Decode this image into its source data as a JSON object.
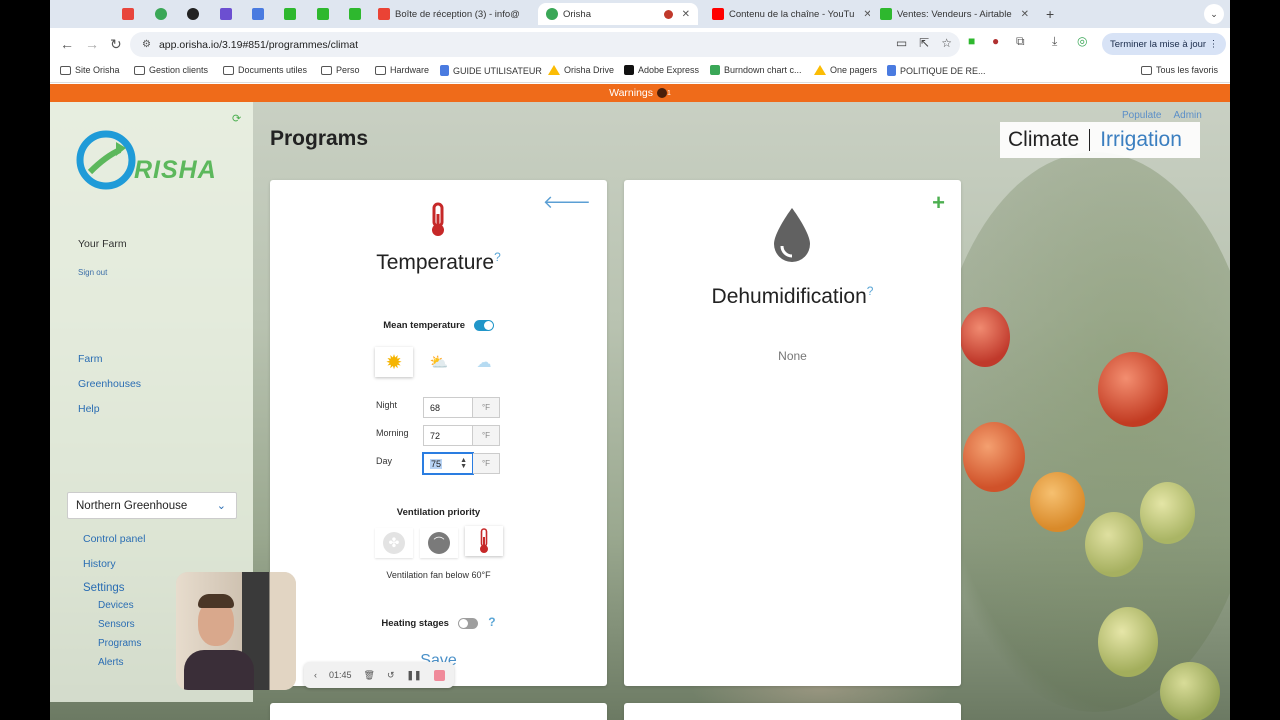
{
  "browser": {
    "tabs": [
      {
        "label": "",
        "color": "#e8453c"
      },
      {
        "label": "",
        "color": "#3aa757"
      },
      {
        "label": "",
        "color": "#222222"
      },
      {
        "label": "S",
        "color": "#6c4fd1"
      },
      {
        "label": "",
        "color": "#4a7be0"
      },
      {
        "label": "",
        "color": "#2eb82e"
      },
      {
        "label": "",
        "color": "#2eb82e"
      },
      {
        "label": "",
        "color": "#2eb82e"
      },
      {
        "label": "Boîte de réception (3) - info@",
        "color": "#ea4335"
      },
      {
        "label": "Orisha",
        "color": "#3aa757",
        "active": true
      },
      {
        "label": "",
        "color": "#c0392b"
      },
      {
        "label": "Contenu de la chaîne - YouTu",
        "color": "#ff0000"
      },
      {
        "label": "Ventes: Vendeurs - Airtable",
        "color": "#2eb82e"
      }
    ],
    "url": "app.orisha.io/3.19#851/programmes/climat",
    "update_button": "Terminer la mise à jour",
    "bookmarks": [
      {
        "label": "Site Orisha",
        "icon": "folder"
      },
      {
        "label": "Gestion clients",
        "icon": "folder"
      },
      {
        "label": "Documents utiles",
        "icon": "folder"
      },
      {
        "label": "Perso",
        "icon": "folder"
      },
      {
        "label": "Hardware",
        "icon": "folder"
      },
      {
        "label": "GUIDE UTILISATEUR",
        "icon": "doc"
      },
      {
        "label": "Orisha Drive",
        "icon": "drive"
      },
      {
        "label": "Adobe Express",
        "icon": "adobe"
      },
      {
        "label": "Burndown chart c...",
        "icon": "green"
      },
      {
        "label": "One pagers",
        "icon": "drive"
      },
      {
        "label": "POLITIQUE DE RE...",
        "icon": "doc"
      }
    ],
    "all_bookmarks": "Tous les favoris"
  },
  "warning_bar": {
    "label": "Warnings",
    "count": "1",
    "color": "#ef6b1a"
  },
  "sidebar": {
    "brand": "RISHA",
    "farm_label": "Your Farm",
    "sign_out": "Sign out",
    "nav": [
      "Farm",
      "Greenhouses",
      "Help"
    ],
    "greenhouse": "Northern Greenhouse",
    "subnav": [
      "Control panel",
      "History",
      "Settings"
    ],
    "settings_items": [
      "Devices",
      "Sensors",
      "Programs",
      "Alerts"
    ]
  },
  "page": {
    "title": "Programs",
    "top_links": [
      "Populate",
      "Admin"
    ],
    "segment_left": "Climate",
    "segment_right": "Irrigation"
  },
  "temperature_card": {
    "title": "Temperature",
    "help": "?",
    "mean_label": "Mean temperature",
    "mean_on": true,
    "rows": [
      {
        "label": "Night",
        "value": "68",
        "unit": "°F"
      },
      {
        "label": "Morning",
        "value": "72",
        "unit": "°F"
      },
      {
        "label": "Day",
        "value": "75",
        "unit": "°F"
      }
    ],
    "vent_title": "Ventilation priority",
    "vent_note": "Ventilation fan below 60°F",
    "heating_label": "Heating stages",
    "heating_on": false,
    "save": "Save"
  },
  "dehum_card": {
    "title": "Dehumidification",
    "help": "?",
    "value": "None"
  },
  "recorder": {
    "time": "01:45"
  },
  "colors": {
    "accent": "#2a6db3",
    "toggle_on": "#2196c9",
    "logo_blue": "#1f9bd8",
    "logo_green": "#5cb85c"
  }
}
